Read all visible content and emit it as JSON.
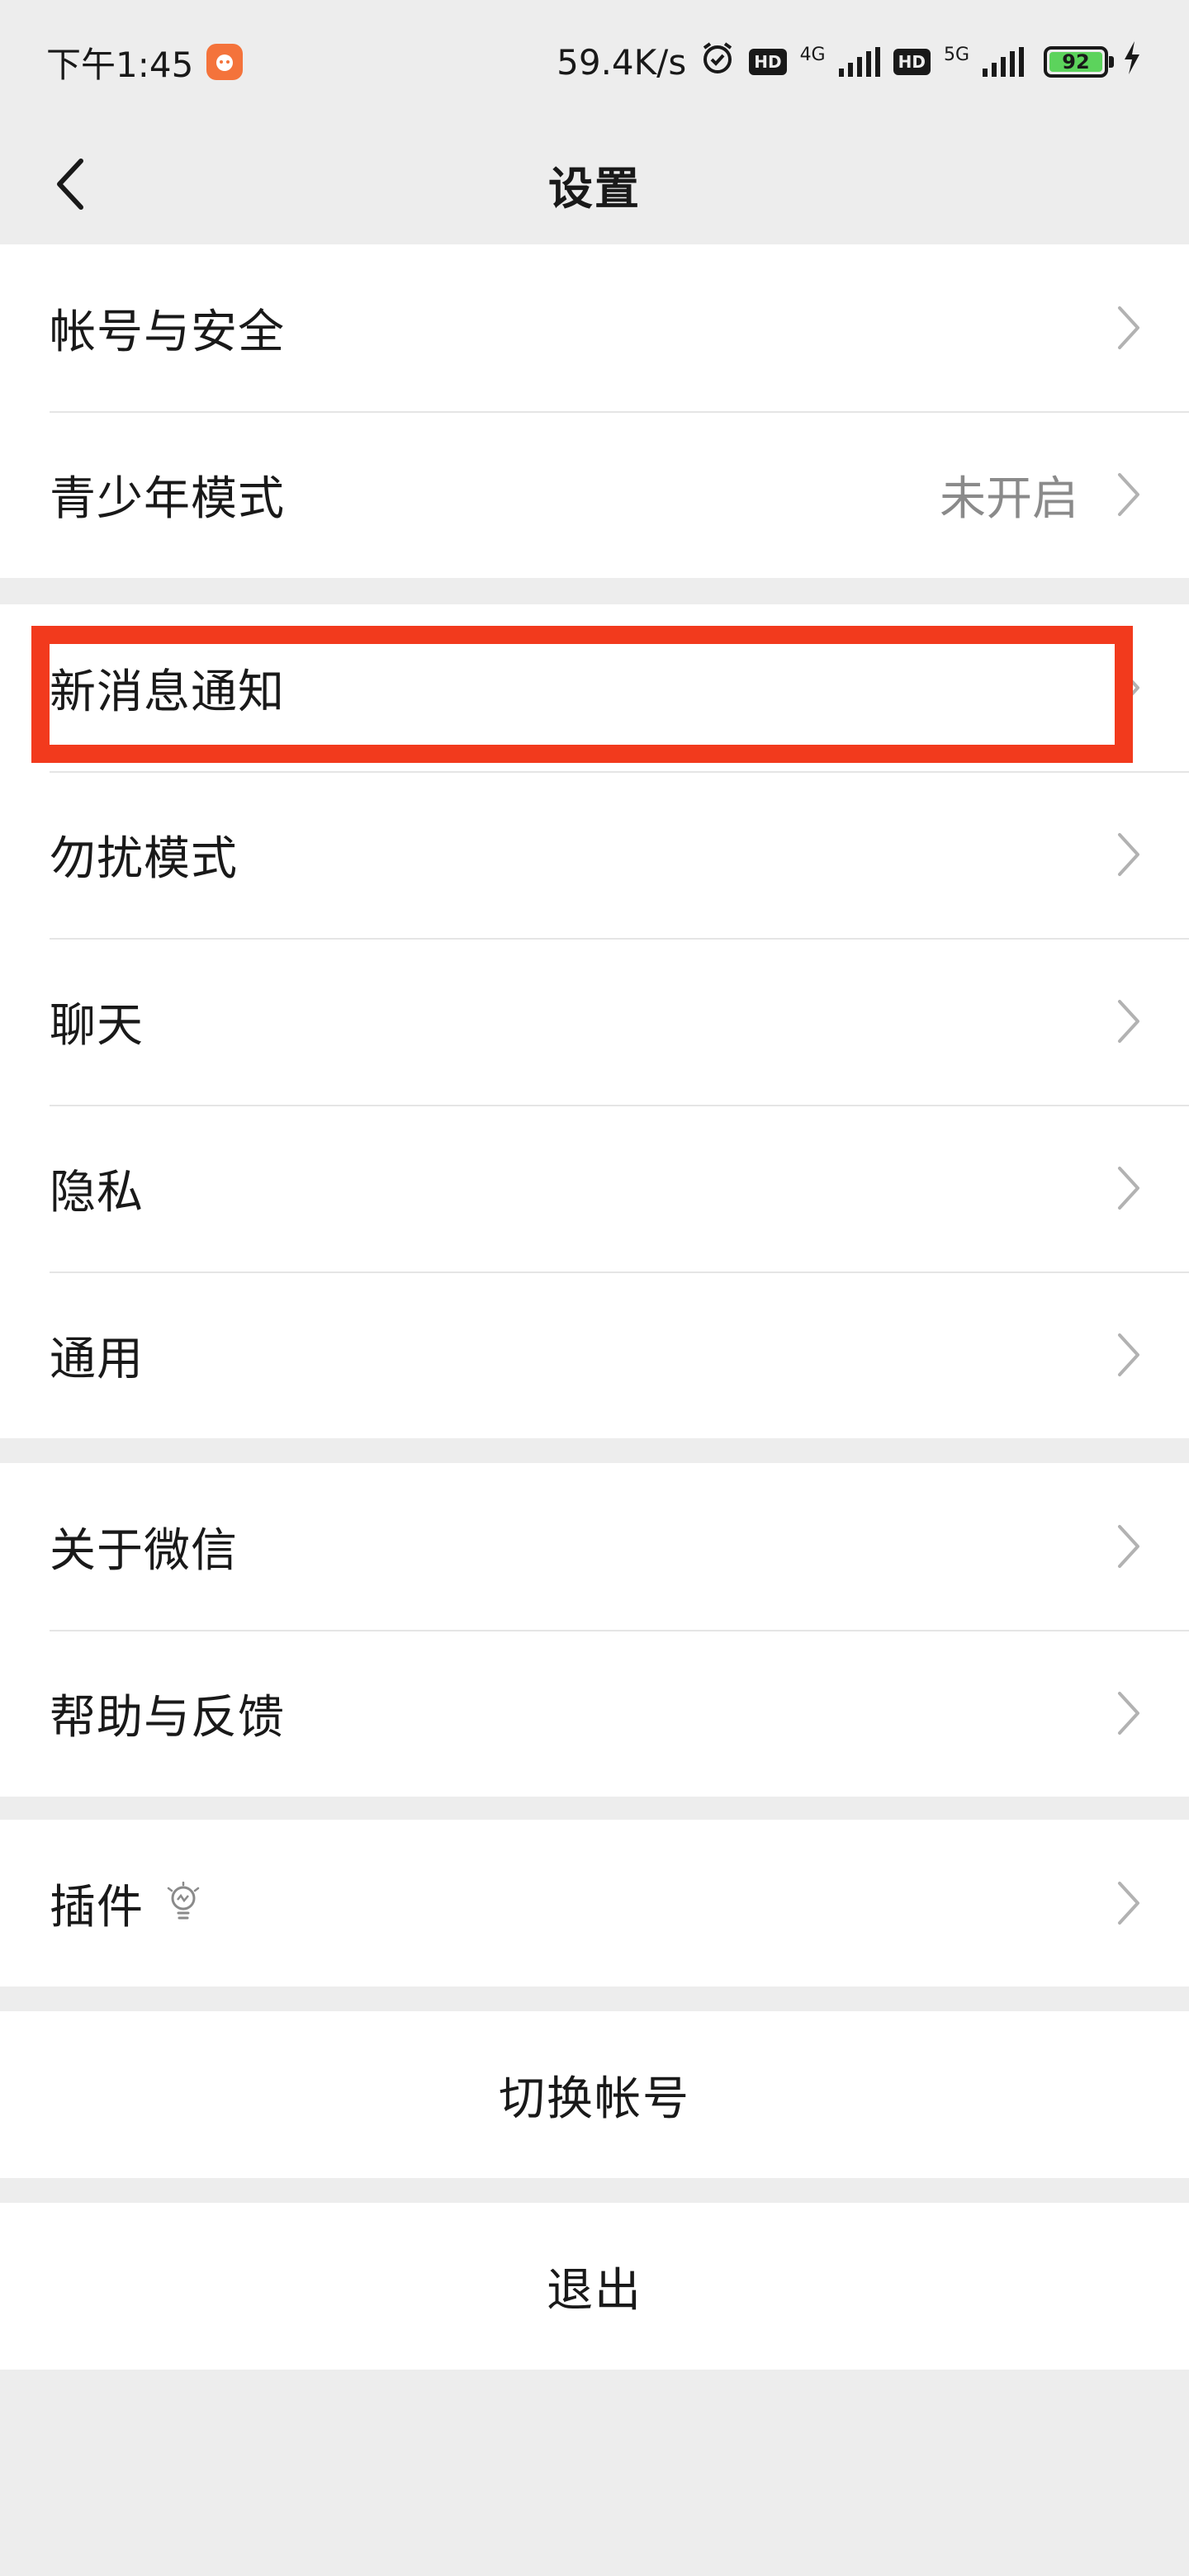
{
  "status_bar": {
    "time": "下午1:45",
    "net_speed": "59.4K/s",
    "hd_label": "HD",
    "net_4g": "4G",
    "net_5g": "5G",
    "battery": "92"
  },
  "header": {
    "title": "设置"
  },
  "groups": {
    "account": {
      "items": [
        {
          "label": "帐号与安全"
        },
        {
          "label": "青少年模式",
          "value": "未开启"
        }
      ]
    },
    "notifications": {
      "items": [
        {
          "label": "新消息通知"
        },
        {
          "label": "勿扰模式"
        },
        {
          "label": "聊天"
        },
        {
          "label": "隐私"
        },
        {
          "label": "通用"
        }
      ]
    },
    "about": {
      "items": [
        {
          "label": "关于微信"
        },
        {
          "label": "帮助与反馈"
        }
      ]
    },
    "plugins": {
      "items": [
        {
          "label": "插件"
        }
      ]
    }
  },
  "actions": {
    "switch_account": "切换帐号",
    "logout": "退出"
  },
  "colors": {
    "background": "#ededed",
    "card": "#ffffff",
    "highlight": "#f23a1d",
    "secondary_text": "#8a8a8a"
  }
}
